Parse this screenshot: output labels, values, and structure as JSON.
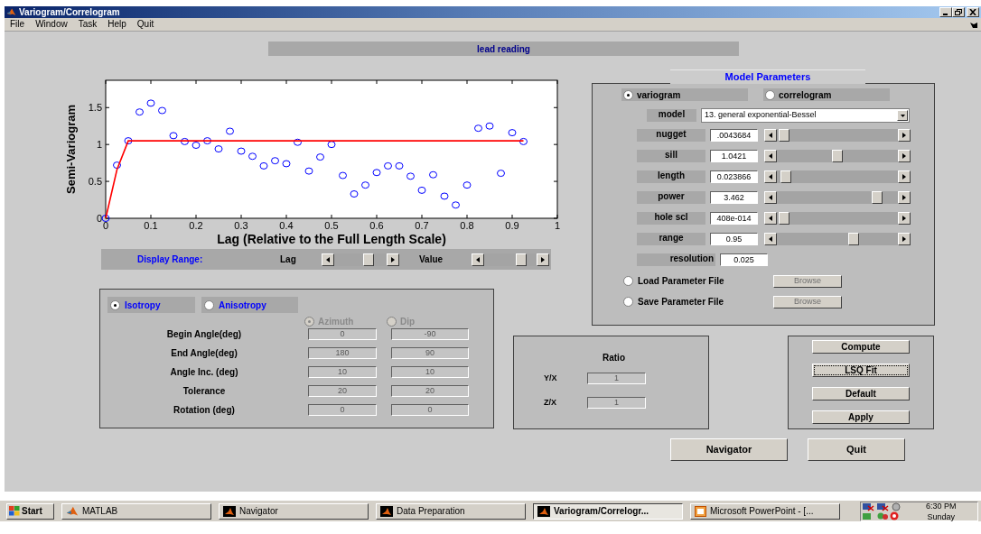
{
  "window": {
    "title": "Variogram/Correlogram"
  },
  "menu": [
    "File",
    "Window",
    "Task",
    "Help",
    "Quit"
  ],
  "header": {
    "text": "lead reading"
  },
  "chart_data": {
    "type": "scatter",
    "xlabel": "Lag (Relative to the Full Length Scale)",
    "ylabel": "Semi-Variogram",
    "xlim": [
      0,
      1
    ],
    "ylim": [
      0,
      1.87
    ],
    "xticks": [
      0,
      0.1,
      0.2,
      0.3,
      0.4,
      0.5,
      0.6,
      0.7,
      0.8,
      0.9,
      1
    ],
    "yticks": [
      0,
      0.5,
      1,
      1.5
    ],
    "series": [
      {
        "type": "scatter",
        "color": "#0000ff",
        "x": [
          0,
          0.025,
          0.05,
          0.075,
          0.1,
          0.125,
          0.15,
          0.175,
          0.2,
          0.225,
          0.25,
          0.275,
          0.3,
          0.325,
          0.35,
          0.375,
          0.4,
          0.425,
          0.45,
          0.475,
          0.5,
          0.525,
          0.55,
          0.575,
          0.6,
          0.625,
          0.65,
          0.675,
          0.7,
          0.725,
          0.75,
          0.775,
          0.8,
          0.825,
          0.85,
          0.875,
          0.9,
          0.925
        ],
        "values": [
          0,
          0.72,
          1.05,
          1.44,
          1.56,
          1.46,
          1.12,
          1.04,
          0.99,
          1.05,
          0.94,
          1.18,
          0.91,
          0.84,
          0.71,
          0.78,
          0.74,
          1.03,
          0.64,
          0.83,
          1.0,
          0.58,
          0.33,
          0.45,
          0.62,
          0.71,
          0.71,
          0.57,
          0.38,
          0.59,
          0.3,
          0.18,
          0.45,
          1.22,
          1.25,
          0.61,
          1.16,
          1.04
        ]
      },
      {
        "type": "line",
        "color": "#ff0000",
        "x": [
          0,
          0.025,
          0.05,
          0.925
        ],
        "values": [
          0,
          0.66,
          1.05,
          1.05
        ]
      }
    ]
  },
  "display_range": {
    "label": "Display Range:",
    "sliders": [
      {
        "label": "Lag",
        "level": 0.7
      },
      {
        "label": "Value",
        "level": 0.75
      }
    ]
  },
  "anisotropy_panel": {
    "disabled": true,
    "modes": [
      {
        "label": "Isotropy",
        "selected": true
      },
      {
        "label": "Anisotropy",
        "selected": false
      }
    ],
    "columns": [
      {
        "label": "Azimuth",
        "selected": true
      },
      {
        "label": "Dip",
        "selected": false
      }
    ],
    "rows": [
      {
        "label": "Begin Angle(deg)",
        "values": [
          "0",
          "-90"
        ]
      },
      {
        "label": "End Angle(deg)",
        "values": [
          "180",
          "90"
        ]
      },
      {
        "label": "Angle Inc. (deg)",
        "values": [
          "10",
          "10"
        ]
      },
      {
        "label": "Tolerance",
        "values": [
          "20",
          "20"
        ]
      },
      {
        "label": "Rotation (deg)",
        "values": [
          "0",
          "0"
        ]
      }
    ]
  },
  "model_parameters": {
    "title": "Model Parameters",
    "types": [
      {
        "label": "variogram",
        "selected": true
      },
      {
        "label": "correlogram",
        "selected": false
      }
    ],
    "model": {
      "label": "model",
      "value": "13. general exponential-Bessel"
    },
    "params": [
      {
        "label": "nugget",
        "value": ".0043684",
        "level": 0.02
      },
      {
        "label": "sill",
        "value": "1.0421",
        "level": 0.5
      },
      {
        "label": "length",
        "value": "0.023866",
        "level": 0.03
      },
      {
        "label": "power",
        "value": "3.462",
        "level": 0.86
      },
      {
        "label": "hole scl",
        "value": "408e-014",
        "level": 0.02
      },
      {
        "label": "range",
        "value": "0.95",
        "level": 0.65
      }
    ],
    "resolution": {
      "label": "resolution",
      "value": "0.025"
    },
    "files": [
      {
        "label": "Load Parameter File",
        "selected": false,
        "button": "Browse",
        "disabled": true
      },
      {
        "label": "Save Parameter File",
        "selected": false,
        "button": "Browse",
        "disabled": true
      }
    ]
  },
  "ratio_panel": {
    "title": "Ratio",
    "disabled": true,
    "rows": [
      {
        "label": "Y/X",
        "value": "1"
      },
      {
        "label": "Z/X",
        "value": "1"
      }
    ]
  },
  "actions": [
    {
      "label": "Compute",
      "focused": false
    },
    {
      "label": "LSQ Fit",
      "focused": true
    },
    {
      "label": "Default",
      "focused": false
    },
    {
      "label": "Apply",
      "focused": false
    }
  ],
  "nav_buttons": [
    "Navigator",
    "Quit"
  ],
  "taskbar": {
    "start": "Start",
    "items": [
      {
        "label": "MATLAB",
        "kind": "matlab",
        "selected": false
      },
      {
        "label": "Navigator",
        "kind": "figure",
        "selected": false
      },
      {
        "label": "Data Preparation",
        "kind": "figure",
        "selected": false
      },
      {
        "label": "Variogram/Correlogr...",
        "kind": "figure",
        "selected": true
      },
      {
        "label": "Microsoft PowerPoint - [...",
        "kind": "powerpoint",
        "selected": false
      }
    ],
    "time": "6:30 PM",
    "day": "Sunday"
  }
}
